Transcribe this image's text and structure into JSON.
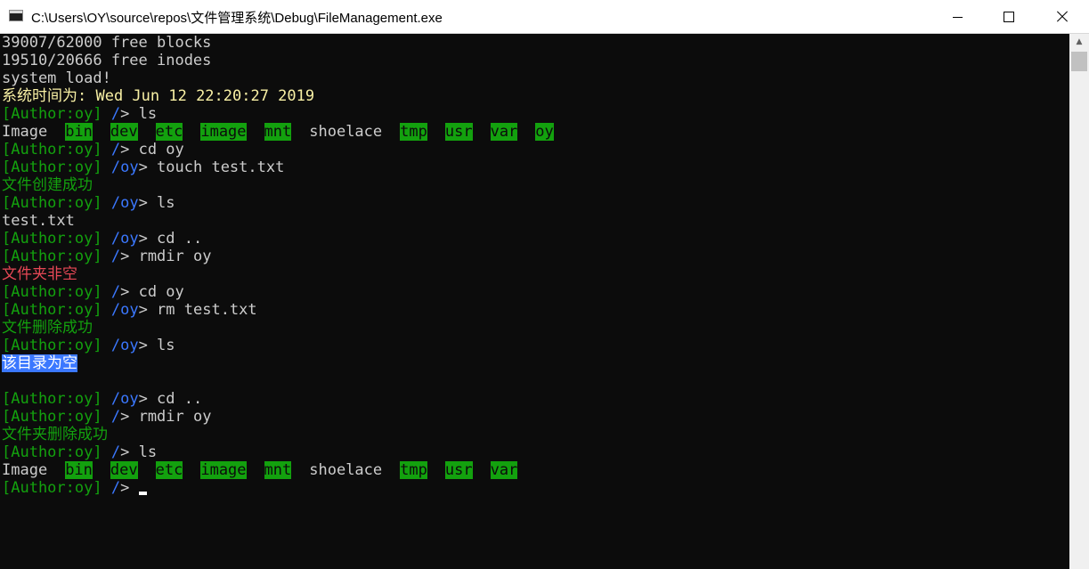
{
  "window": {
    "title": "C:\\Users\\OY\\source\\repos\\文件管理系统\\Debug\\FileManagement.exe",
    "controls": {
      "minimize": "minimize-icon",
      "maximize": "maximize-icon",
      "close": "close-icon"
    }
  },
  "colors": {
    "background": "#0c0c0c",
    "prompt": "#13a10e",
    "path": "#3b78ff",
    "date": "#f9f1a5",
    "error": "#e74856",
    "selection": "#3b78ff"
  },
  "terminal": {
    "lines": [
      {
        "type": "text",
        "text": "39007/62000 free blocks"
      },
      {
        "type": "text",
        "text": "19510/20666 free inodes"
      },
      {
        "type": "text",
        "text": "system load!"
      },
      {
        "type": "sys-time",
        "label": "系统时间为: ",
        "value": "Wed Jun 12 22:20:27 2019"
      },
      {
        "type": "prompt",
        "user": "[Author:oy]",
        "path": "/",
        "cmd": "ls"
      },
      {
        "type": "listing",
        "items": [
          {
            "name": "Image",
            "dir": false
          },
          {
            "name": "bin",
            "dir": true
          },
          {
            "name": "dev",
            "dir": true
          },
          {
            "name": "etc",
            "dir": true
          },
          {
            "name": "image",
            "dir": true
          },
          {
            "name": "mnt",
            "dir": true
          },
          {
            "name": "shoelace",
            "dir": false
          },
          {
            "name": "tmp",
            "dir": true
          },
          {
            "name": "usr",
            "dir": true
          },
          {
            "name": "var",
            "dir": true
          },
          {
            "name": "oy",
            "dir": true
          }
        ]
      },
      {
        "type": "prompt",
        "user": "[Author:oy]",
        "path": "/",
        "cmd": "cd oy"
      },
      {
        "type": "prompt",
        "user": "[Author:oy]",
        "path": "/oy",
        "cmd": "touch test.txt"
      },
      {
        "type": "msg-green",
        "text": "文件创建成功"
      },
      {
        "type": "prompt",
        "user": "[Author:oy]",
        "path": "/oy",
        "cmd": "ls"
      },
      {
        "type": "text",
        "text": "test.txt"
      },
      {
        "type": "prompt",
        "user": "[Author:oy]",
        "path": "/oy",
        "cmd": "cd .."
      },
      {
        "type": "prompt",
        "user": "[Author:oy]",
        "path": "/",
        "cmd": "rmdir oy"
      },
      {
        "type": "msg-red",
        "text": "文件夹非空"
      },
      {
        "type": "prompt",
        "user": "[Author:oy]",
        "path": "/",
        "cmd": "cd oy"
      },
      {
        "type": "prompt",
        "user": "[Author:oy]",
        "path": "/oy",
        "cmd": "rm test.txt"
      },
      {
        "type": "msg-green",
        "text": "文件删除成功"
      },
      {
        "type": "prompt",
        "user": "[Author:oy]",
        "path": "/oy",
        "cmd": "ls"
      },
      {
        "type": "selected",
        "text": "该目录为空"
      },
      {
        "type": "blank"
      },
      {
        "type": "prompt",
        "user": "[Author:oy]",
        "path": "/oy",
        "cmd": "cd .."
      },
      {
        "type": "prompt",
        "user": "[Author:oy]",
        "path": "/",
        "cmd": "rmdir oy"
      },
      {
        "type": "msg-green",
        "text": "文件夹删除成功"
      },
      {
        "type": "prompt",
        "user": "[Author:oy]",
        "path": "/",
        "cmd": "ls"
      },
      {
        "type": "listing",
        "items": [
          {
            "name": "Image",
            "dir": false
          },
          {
            "name": "bin",
            "dir": true
          },
          {
            "name": "dev",
            "dir": true
          },
          {
            "name": "etc",
            "dir": true
          },
          {
            "name": "image",
            "dir": true
          },
          {
            "name": "mnt",
            "dir": true
          },
          {
            "name": "shoelace",
            "dir": false
          },
          {
            "name": "tmp",
            "dir": true
          },
          {
            "name": "usr",
            "dir": true
          },
          {
            "name": "var",
            "dir": true
          }
        ]
      },
      {
        "type": "prompt-cursor",
        "user": "[Author:oy]",
        "path": "/"
      }
    ]
  }
}
